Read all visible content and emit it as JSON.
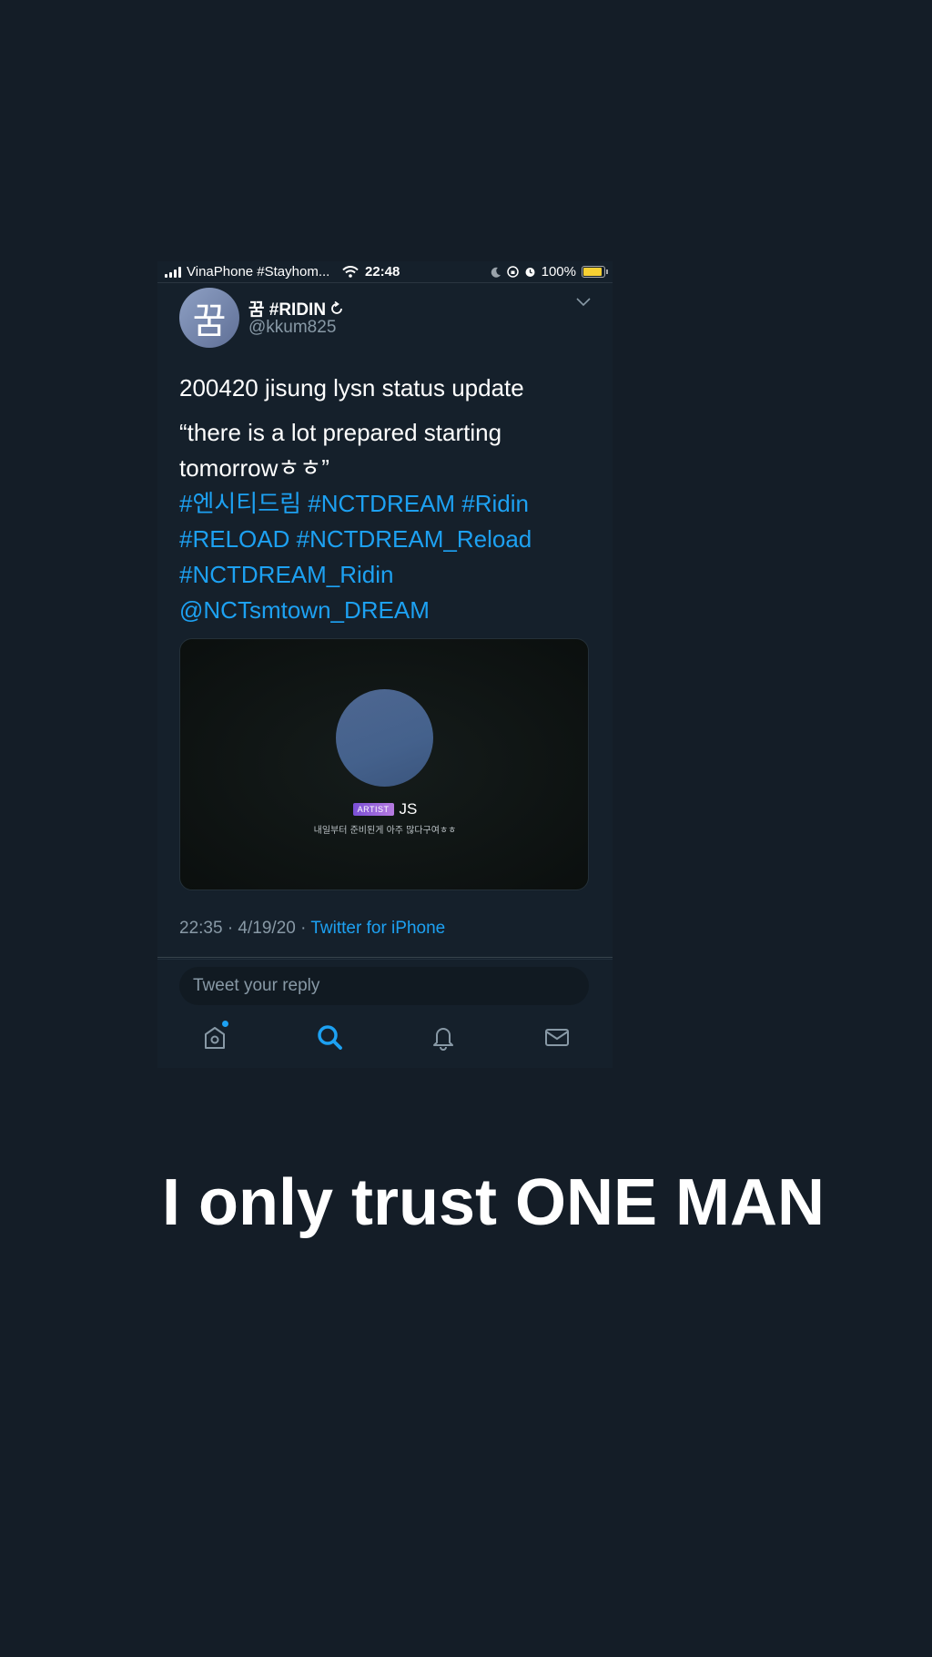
{
  "status_bar": {
    "carrier": "VinaPhone #Stayhom...",
    "time": "22:48",
    "battery": "100%"
  },
  "tweet": {
    "display_name": "꿈 #RIDIN",
    "handle": "@kkum825",
    "avatar_glyph": "꿈",
    "line1": "200420 jisung lysn status update",
    "quote": "“there is a lot prepared starting tomorrowㅎㅎ”",
    "hashtags_1": "#엔시티드림 #NCTDREAM #Ridin",
    "hashtags_2": "#RELOAD #NCTDREAM_Reload",
    "hashtags_3": "#NCTDREAM_Ridin",
    "mention": "@NCTsmtown_DREAM",
    "media": {
      "badge": "ARTIST",
      "name": "JS",
      "caption": "내일부터 준비된게 아주 많다구여ㅎㅎ"
    },
    "timestamp": "22:35 · 4/19/20 · ",
    "source": "Twitter for iPhone"
  },
  "reply": {
    "placeholder": "Tweet your reply"
  },
  "nav": {
    "items": [
      "home-icon",
      "search-icon",
      "notifications-icon",
      "messages-icon"
    ],
    "active": "search-icon",
    "accent": "#1da1f2"
  },
  "caption": "I only trust ONE MAN"
}
